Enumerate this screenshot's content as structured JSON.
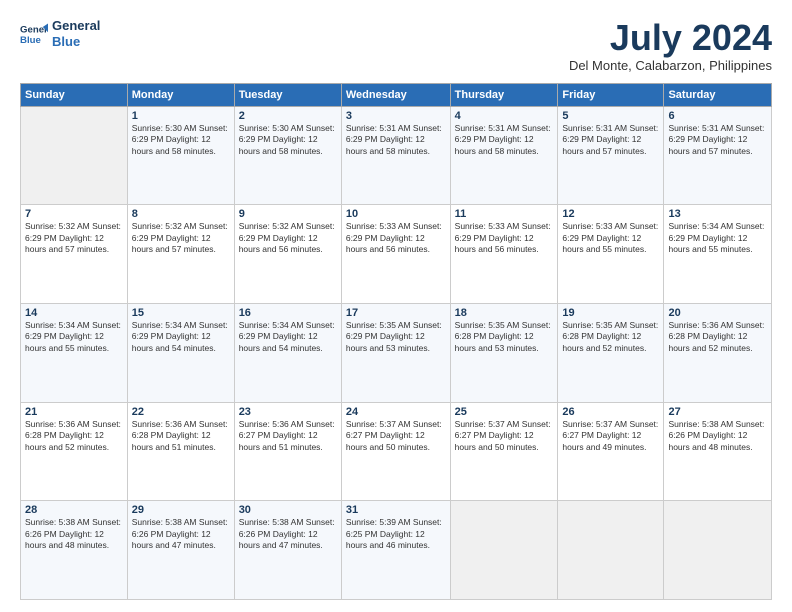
{
  "header": {
    "logo_line1": "General",
    "logo_line2": "Blue",
    "month": "July 2024",
    "location": "Del Monte, Calabarzon, Philippines"
  },
  "days_of_week": [
    "Sunday",
    "Monday",
    "Tuesday",
    "Wednesday",
    "Thursday",
    "Friday",
    "Saturday"
  ],
  "weeks": [
    [
      {
        "num": "",
        "info": ""
      },
      {
        "num": "1",
        "info": "Sunrise: 5:30 AM\nSunset: 6:29 PM\nDaylight: 12 hours\nand 58 minutes."
      },
      {
        "num": "2",
        "info": "Sunrise: 5:30 AM\nSunset: 6:29 PM\nDaylight: 12 hours\nand 58 minutes."
      },
      {
        "num": "3",
        "info": "Sunrise: 5:31 AM\nSunset: 6:29 PM\nDaylight: 12 hours\nand 58 minutes."
      },
      {
        "num": "4",
        "info": "Sunrise: 5:31 AM\nSunset: 6:29 PM\nDaylight: 12 hours\nand 58 minutes."
      },
      {
        "num": "5",
        "info": "Sunrise: 5:31 AM\nSunset: 6:29 PM\nDaylight: 12 hours\nand 57 minutes."
      },
      {
        "num": "6",
        "info": "Sunrise: 5:31 AM\nSunset: 6:29 PM\nDaylight: 12 hours\nand 57 minutes."
      }
    ],
    [
      {
        "num": "7",
        "info": "Sunrise: 5:32 AM\nSunset: 6:29 PM\nDaylight: 12 hours\nand 57 minutes."
      },
      {
        "num": "8",
        "info": "Sunrise: 5:32 AM\nSunset: 6:29 PM\nDaylight: 12 hours\nand 57 minutes."
      },
      {
        "num": "9",
        "info": "Sunrise: 5:32 AM\nSunset: 6:29 PM\nDaylight: 12 hours\nand 56 minutes."
      },
      {
        "num": "10",
        "info": "Sunrise: 5:33 AM\nSunset: 6:29 PM\nDaylight: 12 hours\nand 56 minutes."
      },
      {
        "num": "11",
        "info": "Sunrise: 5:33 AM\nSunset: 6:29 PM\nDaylight: 12 hours\nand 56 minutes."
      },
      {
        "num": "12",
        "info": "Sunrise: 5:33 AM\nSunset: 6:29 PM\nDaylight: 12 hours\nand 55 minutes."
      },
      {
        "num": "13",
        "info": "Sunrise: 5:34 AM\nSunset: 6:29 PM\nDaylight: 12 hours\nand 55 minutes."
      }
    ],
    [
      {
        "num": "14",
        "info": "Sunrise: 5:34 AM\nSunset: 6:29 PM\nDaylight: 12 hours\nand 55 minutes."
      },
      {
        "num": "15",
        "info": "Sunrise: 5:34 AM\nSunset: 6:29 PM\nDaylight: 12 hours\nand 54 minutes."
      },
      {
        "num": "16",
        "info": "Sunrise: 5:34 AM\nSunset: 6:29 PM\nDaylight: 12 hours\nand 54 minutes."
      },
      {
        "num": "17",
        "info": "Sunrise: 5:35 AM\nSunset: 6:29 PM\nDaylight: 12 hours\nand 53 minutes."
      },
      {
        "num": "18",
        "info": "Sunrise: 5:35 AM\nSunset: 6:28 PM\nDaylight: 12 hours\nand 53 minutes."
      },
      {
        "num": "19",
        "info": "Sunrise: 5:35 AM\nSunset: 6:28 PM\nDaylight: 12 hours\nand 52 minutes."
      },
      {
        "num": "20",
        "info": "Sunrise: 5:36 AM\nSunset: 6:28 PM\nDaylight: 12 hours\nand 52 minutes."
      }
    ],
    [
      {
        "num": "21",
        "info": "Sunrise: 5:36 AM\nSunset: 6:28 PM\nDaylight: 12 hours\nand 52 minutes."
      },
      {
        "num": "22",
        "info": "Sunrise: 5:36 AM\nSunset: 6:28 PM\nDaylight: 12 hours\nand 51 minutes."
      },
      {
        "num": "23",
        "info": "Sunrise: 5:36 AM\nSunset: 6:27 PM\nDaylight: 12 hours\nand 51 minutes."
      },
      {
        "num": "24",
        "info": "Sunrise: 5:37 AM\nSunset: 6:27 PM\nDaylight: 12 hours\nand 50 minutes."
      },
      {
        "num": "25",
        "info": "Sunrise: 5:37 AM\nSunset: 6:27 PM\nDaylight: 12 hours\nand 50 minutes."
      },
      {
        "num": "26",
        "info": "Sunrise: 5:37 AM\nSunset: 6:27 PM\nDaylight: 12 hours\nand 49 minutes."
      },
      {
        "num": "27",
        "info": "Sunrise: 5:38 AM\nSunset: 6:26 PM\nDaylight: 12 hours\nand 48 minutes."
      }
    ],
    [
      {
        "num": "28",
        "info": "Sunrise: 5:38 AM\nSunset: 6:26 PM\nDaylight: 12 hours\nand 48 minutes."
      },
      {
        "num": "29",
        "info": "Sunrise: 5:38 AM\nSunset: 6:26 PM\nDaylight: 12 hours\nand 47 minutes."
      },
      {
        "num": "30",
        "info": "Sunrise: 5:38 AM\nSunset: 6:26 PM\nDaylight: 12 hours\nand 47 minutes."
      },
      {
        "num": "31",
        "info": "Sunrise: 5:39 AM\nSunset: 6:25 PM\nDaylight: 12 hours\nand 46 minutes."
      },
      {
        "num": "",
        "info": ""
      },
      {
        "num": "",
        "info": ""
      },
      {
        "num": "",
        "info": ""
      }
    ]
  ]
}
